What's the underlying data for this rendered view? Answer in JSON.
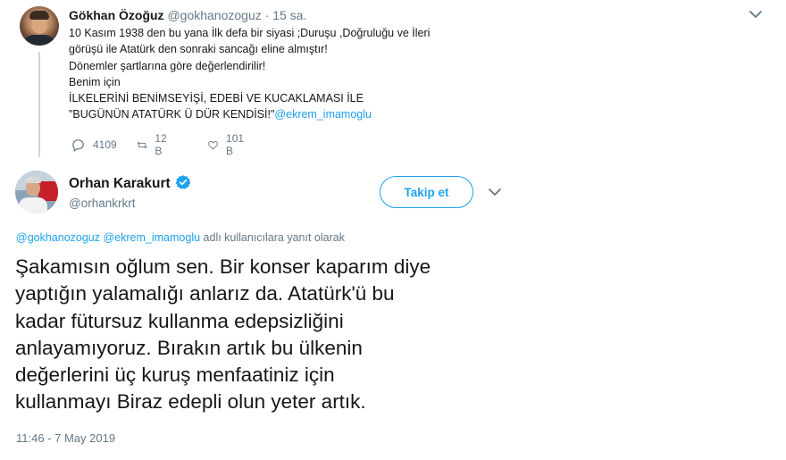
{
  "parent_tweet": {
    "author_name": "Gökhan Özoğuz",
    "handle": "@gokhanozoguz",
    "separator": "·",
    "time": "15 sa.",
    "text_lines": [
      {
        "text": "10 Kasım 1938 den bu yana İlk defa bir siyasi ;Duruşu ,Doğruluğu ve İleri",
        "mention": ""
      },
      {
        "text": "görüşü ile Atatürk den sonraki sancağı eline almıştır!",
        "mention": ""
      },
      {
        "text": "Dönemler şartlarına göre değerlendirilir!",
        "mention": ""
      },
      {
        "text": "Benim için",
        "mention": ""
      },
      {
        "text": "İLKELERİNİ BENİMSEYİŞİ, EDEBİ VE KUCAKLAMASI İLE",
        "mention": ""
      },
      {
        "text": "\"BUGÜNÜN ATATÜRK Ü DÜR KENDİSİ!\"",
        "mention": "@ekrem_imamoglu"
      }
    ],
    "actions": {
      "reply_count": "4109",
      "retweet_count": "12 B",
      "like_count": "101 B"
    }
  },
  "main_tweet": {
    "author_name": "Orhan Karakurt",
    "handle": "@orhankrkrt",
    "follow_label": "Takip et",
    "reply_to": {
      "mention_1": "@gokhanozoguz",
      "mention_2": "@ekrem_imamoglu",
      "suffix": " adlı kullanıcılara yanıt olarak"
    },
    "text_lines": [
      "Şakamısın oğlum sen. Bir konser kaparım diye",
      "yaptığın yalamalığı anlarız da. Atatürk'ü bu",
      "kadar fütursuz kullanma edepsizliğini",
      "anlayamıyoruz. Bırakın artık bu ülkenin",
      "değerlerini üç kuruş menfaatiniz için",
      "kullanmayı Biraz edepli olun yeter artık."
    ],
    "timestamp": "11:46 - 7 May 2019"
  },
  "colors": {
    "accent": "#1da1f2",
    "secondary_text": "#657786",
    "primary_text": "#14171a",
    "thread_line": "#ccd6dd"
  },
  "icons": [
    "chevron-down-icon",
    "reply-icon",
    "retweet-icon",
    "like-icon",
    "verified-badge-icon"
  ]
}
